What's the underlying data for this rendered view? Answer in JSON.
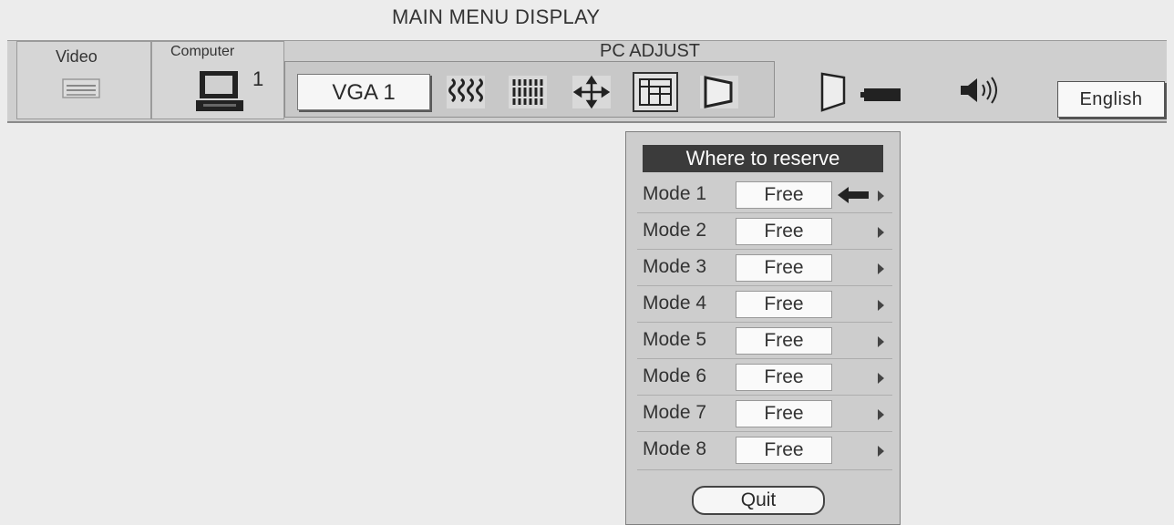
{
  "title": "MAIN MENU DISPLAY",
  "menubar": {
    "video_label": "Video",
    "computer_label": "Computer",
    "computer_number": "1",
    "pc_adjust_label": "PC ADJUST",
    "vga_label": "VGA 1",
    "icons": [
      "fine-sync-icon",
      "total-dots-icon",
      "position-icon",
      "mode-memory-icon",
      "keystone-icon",
      "projector-icon",
      "volume-icon"
    ],
    "language_label": "English"
  },
  "reserve_panel": {
    "header": "Where to reserve",
    "modes": [
      {
        "label": "Mode 1",
        "value": "Free"
      },
      {
        "label": "Mode 2",
        "value": "Free"
      },
      {
        "label": "Mode 3",
        "value": "Free"
      },
      {
        "label": "Mode 4",
        "value": "Free"
      },
      {
        "label": "Mode 5",
        "value": "Free"
      },
      {
        "label": "Mode 6",
        "value": "Free"
      },
      {
        "label": "Mode 7",
        "value": "Free"
      },
      {
        "label": "Mode 8",
        "value": "Free"
      }
    ],
    "quit_label": "Quit"
  }
}
